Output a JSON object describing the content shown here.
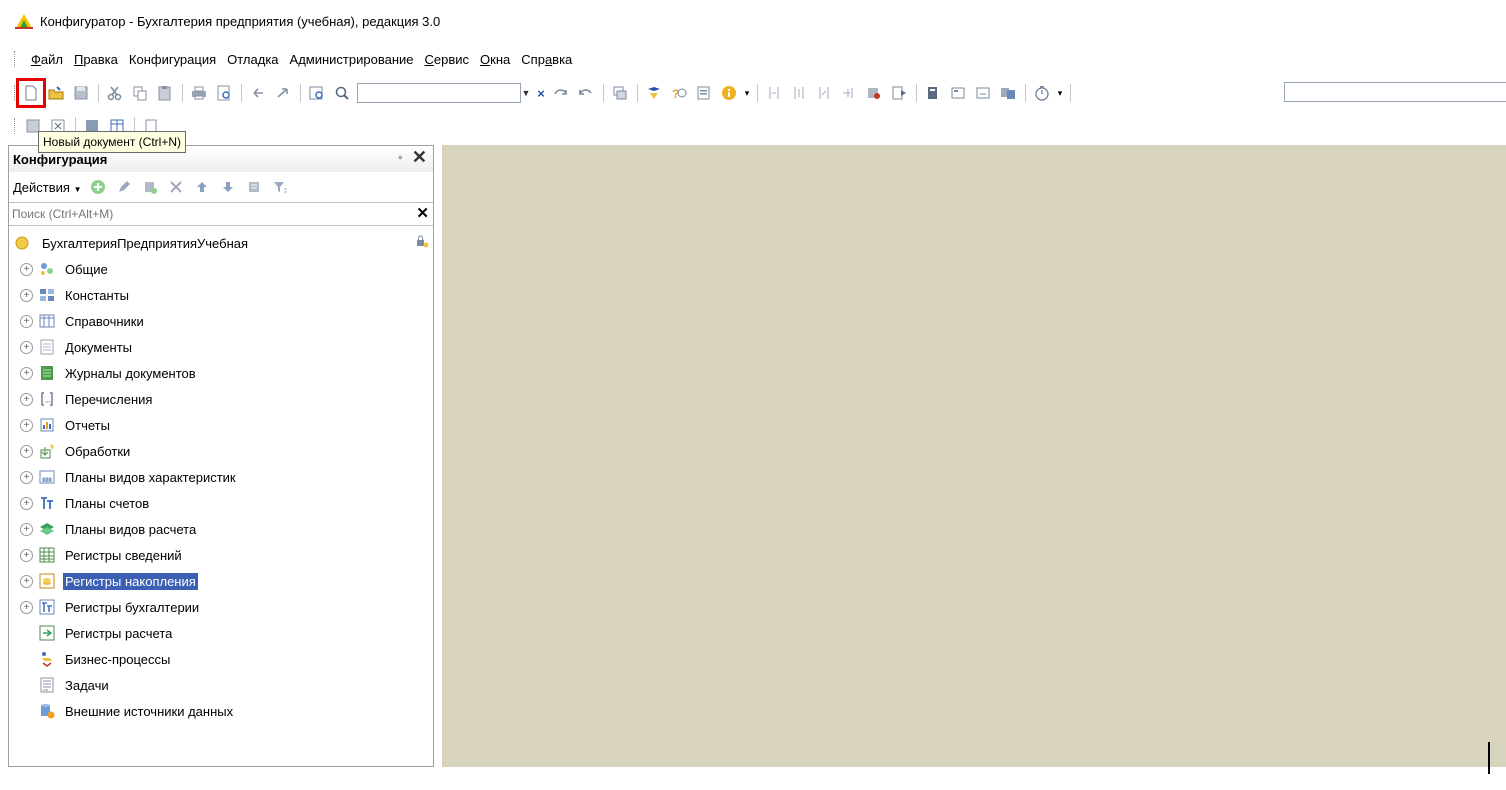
{
  "window": {
    "title": "Конфигуратор - Бухгалтерия предприятия (учебная), редакция 3.0"
  },
  "menu": {
    "items": [
      {
        "label": "Файл"
      },
      {
        "label": "Правка"
      },
      {
        "label": "Конфигурация"
      },
      {
        "label": "Отладка"
      },
      {
        "label": "Администрирование"
      },
      {
        "label": "Сервис"
      },
      {
        "label": "Окна"
      },
      {
        "label": "Справка"
      }
    ]
  },
  "toolbar": {
    "search_value": "",
    "right_combo_value": "",
    "tooltip": "Новый документ (Ctrl+N)",
    "highlighted": "new-document"
  },
  "panel": {
    "title": "Конфигурация",
    "actions_label": "Действия",
    "search_placeholder": "Поиск (Ctrl+Alt+M)",
    "root": "БухгалтерияПредприятияУчебная",
    "items": [
      {
        "label": "Общие",
        "icon": "common-icon",
        "expandable": true
      },
      {
        "label": "Константы",
        "icon": "constants-icon",
        "expandable": true
      },
      {
        "label": "Справочники",
        "icon": "catalogs-icon",
        "expandable": true
      },
      {
        "label": "Документы",
        "icon": "documents-icon",
        "expandable": true
      },
      {
        "label": "Журналы документов",
        "icon": "journals-icon",
        "expandable": true
      },
      {
        "label": "Перечисления",
        "icon": "enums-icon",
        "expandable": true
      },
      {
        "label": "Отчеты",
        "icon": "reports-icon",
        "expandable": true
      },
      {
        "label": "Обработки",
        "icon": "dataprocessors-icon",
        "expandable": true
      },
      {
        "label": "Планы видов характеристик",
        "icon": "chart-of-characteristic-types-icon",
        "expandable": true
      },
      {
        "label": "Планы счетов",
        "icon": "chart-of-accounts-icon",
        "expandable": true
      },
      {
        "label": "Планы видов расчета",
        "icon": "chart-of-calculation-types-icon",
        "expandable": true
      },
      {
        "label": "Регистры сведений",
        "icon": "information-registers-icon",
        "expandable": true
      },
      {
        "label": "Регистры накопления",
        "icon": "accumulation-registers-icon",
        "expandable": true,
        "selected": true
      },
      {
        "label": "Регистры бухгалтерии",
        "icon": "accounting-registers-icon",
        "expandable": true
      },
      {
        "label": "Регистры расчета",
        "icon": "calculation-registers-icon",
        "expandable": false
      },
      {
        "label": "Бизнес-процессы",
        "icon": "business-processes-icon",
        "expandable": false
      },
      {
        "label": "Задачи",
        "icon": "tasks-icon",
        "expandable": false
      },
      {
        "label": "Внешние источники данных",
        "icon": "external-data-sources-icon",
        "expandable": false
      }
    ]
  },
  "colors": {
    "workspace": "#d8d3bc",
    "selection": "#3c5fb4",
    "highlight": "#e60000"
  }
}
